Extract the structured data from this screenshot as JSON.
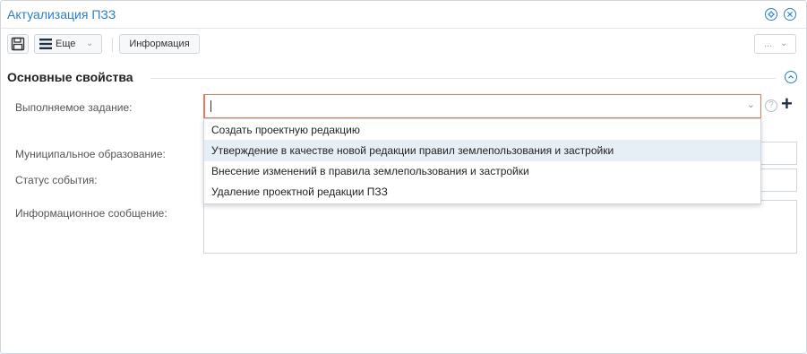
{
  "window": {
    "title": "Актуализация ПЗЗ",
    "settings_icon": "gear-circle-icon",
    "close_icon": "close-circle-icon"
  },
  "toolbar": {
    "save_icon": "floppy-disk-icon",
    "more_label": "Еще",
    "info_label": "Информация",
    "overflow_label": "..."
  },
  "section": {
    "title": "Основные свойства"
  },
  "form": {
    "task_label": "Выполняемое задание:",
    "task_value": "",
    "municipality_label": "Муниципальное образование:",
    "status_label": "Статус события:",
    "message_label": "Информационное сообщение:"
  },
  "dropdown": {
    "options": [
      "Создать проектную редакцию",
      "Утверждение в качестве новой редакции правил землепользования и застройки",
      "Внесение изменений в правила землепользования и застройки",
      "Удаление проектной редакции ПЗЗ"
    ],
    "highlighted_index": 1
  },
  "colors": {
    "accent": "#2c7fc4",
    "error_border": "#e97a5a",
    "highlight": "#e6eef6"
  }
}
